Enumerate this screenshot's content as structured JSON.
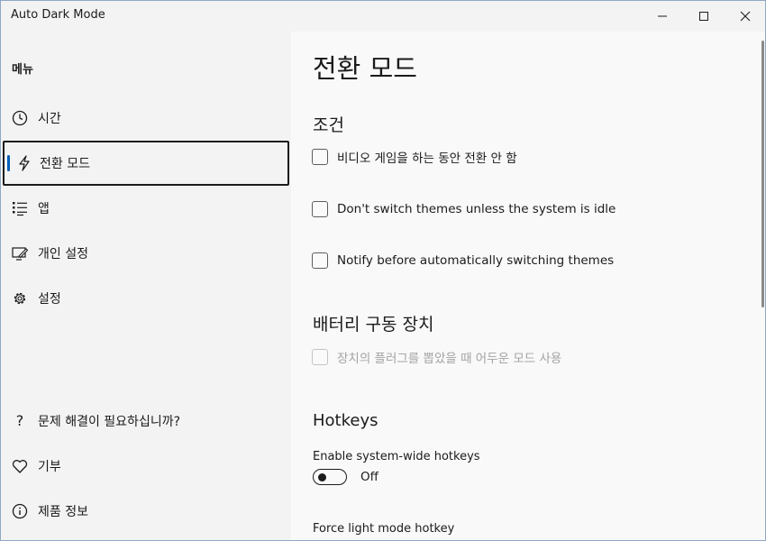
{
  "window": {
    "title": "Auto Dark Mode"
  },
  "sidebar": {
    "menu_label": "메뉴",
    "items": [
      {
        "label": "시간",
        "icon": "clock-icon"
      },
      {
        "label": "전환 모드",
        "icon": "lightning-icon",
        "selected": true
      },
      {
        "label": "앱",
        "icon": "list-icon"
      },
      {
        "label": "개인 설정",
        "icon": "personalize-icon"
      },
      {
        "label": "설정",
        "icon": "gear-icon"
      }
    ],
    "footer_items": [
      {
        "label": "문제 해결이 필요하십니까?",
        "icon": "question-icon"
      },
      {
        "label": "기부",
        "icon": "heart-icon"
      },
      {
        "label": "제품 정보",
        "icon": "info-icon"
      }
    ]
  },
  "main": {
    "title": "전환 모드",
    "conditions": {
      "heading": "조건",
      "options": [
        {
          "label": "비디오 게임을 하는 동안 전환 안 함",
          "checked": false
        },
        {
          "label": "Don't switch themes unless the system is idle",
          "checked": false
        },
        {
          "label": "Notify before automatically switching themes",
          "checked": false
        }
      ]
    },
    "battery": {
      "heading": "배터리 구동 장치",
      "option": {
        "label": "장치의 플러그를 뽑았을 때 어두운 모드 사용",
        "checked": false,
        "disabled": true
      }
    },
    "hotkeys": {
      "heading": "Hotkeys",
      "enable_label": "Enable system-wide hotkeys",
      "toggle_state": "Off",
      "force_light_label": "Force light mode hotkey"
    }
  },
  "colors": {
    "accent": "#005fb8",
    "content_bg": "#f9f9f9",
    "sidebar_bg": "#f3f3f3"
  }
}
